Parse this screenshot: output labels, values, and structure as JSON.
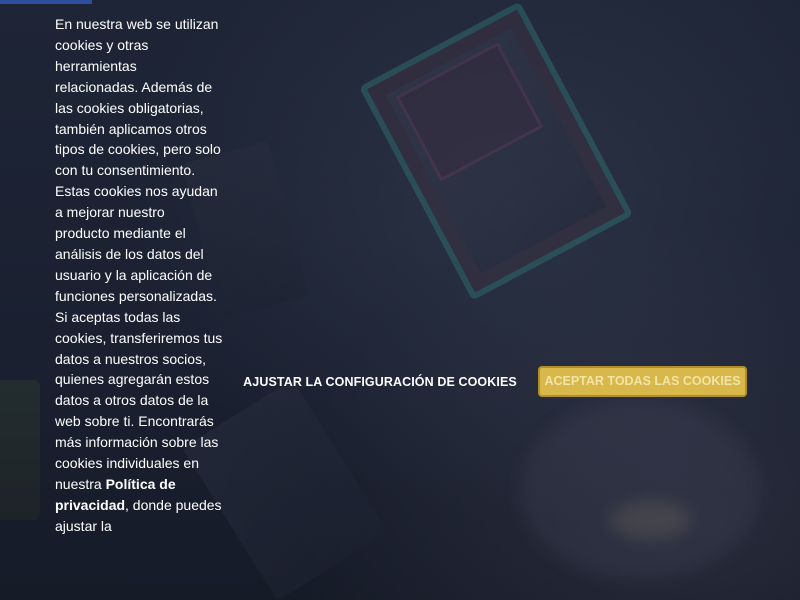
{
  "cookie_banner": {
    "text_before_link": "En nuestra web se utilizan cookies y otras herramientas relacionadas. Además de las cookies obligatorias, también aplicamos otros tipos de cookies, pero solo con tu consentimiento. Estas cookies nos ayudan a mejorar nuestro producto mediante el análisis de los datos del usuario y la aplicación de funciones personalizadas. Si aceptas todas las cookies, transferiremos tus datos a nuestros socios, quienes agregarán estos datos a otros datos de la web sobre ti. Encontrarás más información sobre las cookies individuales en nuestra",
    "privacy_link_label": "Política de privacidad",
    "text_after_link": ", donde puedes ajustar la",
    "adjust_button_label": "AJUSTAR LA CONFIGURACIÓN DE COOKIES",
    "accept_button_label": "ACEPTAR TODAS LAS COOKIES"
  },
  "colors": {
    "overlay_background": "#1b2232",
    "accept_button": "#d8b84a",
    "accent_bar": "#2f4f9e",
    "text": "#ffffff"
  }
}
